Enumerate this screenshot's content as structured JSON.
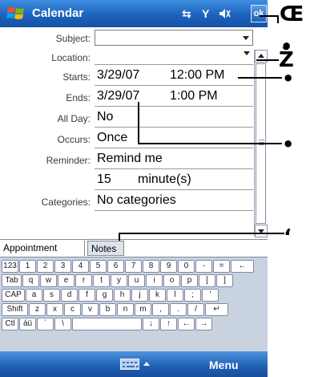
{
  "titlebar": {
    "title": "Calendar",
    "ok_label": "ok",
    "icons": [
      "windows-start-icon",
      "connectivity-icon",
      "signal-icon",
      "volume-icon"
    ]
  },
  "form": {
    "subject_label": "Subject:",
    "subject_value": "",
    "location_label": "Location:",
    "location_value": "",
    "starts_label": "Starts:",
    "starts_date": "3/29/07",
    "starts_time": "12:00 PM",
    "ends_label": "Ends:",
    "ends_date": "3/29/07",
    "ends_time": "1:00 PM",
    "allday_label": "All Day:",
    "allday_value": "No",
    "occurs_label": "Occurs:",
    "occurs_value": "Once",
    "reminder_label": "Reminder:",
    "reminder_value": "Remind me",
    "reminder_amount": "15",
    "reminder_unit": "minute(s)",
    "categories_label": "Categories:",
    "categories_value": "No categories"
  },
  "tabs": [
    "Appointment",
    "Notes"
  ],
  "keyboard": {
    "rows": [
      [
        "123",
        "1",
        "2",
        "3",
        "4",
        "5",
        "6",
        "7",
        "8",
        "9",
        "0",
        "-",
        "=",
        "←"
      ],
      [
        "Tab",
        "q",
        "w",
        "e",
        "r",
        "t",
        "y",
        "u",
        "i",
        "o",
        "p",
        "[",
        "]"
      ],
      [
        "CAP",
        "a",
        "s",
        "d",
        "f",
        "g",
        "h",
        "j",
        "k",
        "l",
        ";",
        "'"
      ],
      [
        "Shift",
        "z",
        "x",
        "c",
        "v",
        "b",
        "n",
        "m",
        ",",
        ".",
        "/",
        "↵"
      ],
      [
        "Ctl",
        "áü",
        "`",
        "\\",
        "",
        "↓",
        "↑",
        "←",
        "→"
      ]
    ]
  },
  "menubar": {
    "menu_label": "Menu"
  },
  "callouts": [
    {
      "glyph": "Œ"
    },
    {
      "glyph": "•"
    },
    {
      "glyph": "Ž"
    },
    {
      "glyph": "•"
    },
    {
      "glyph": "•"
    },
    {
      "glyph": "‘"
    }
  ]
}
